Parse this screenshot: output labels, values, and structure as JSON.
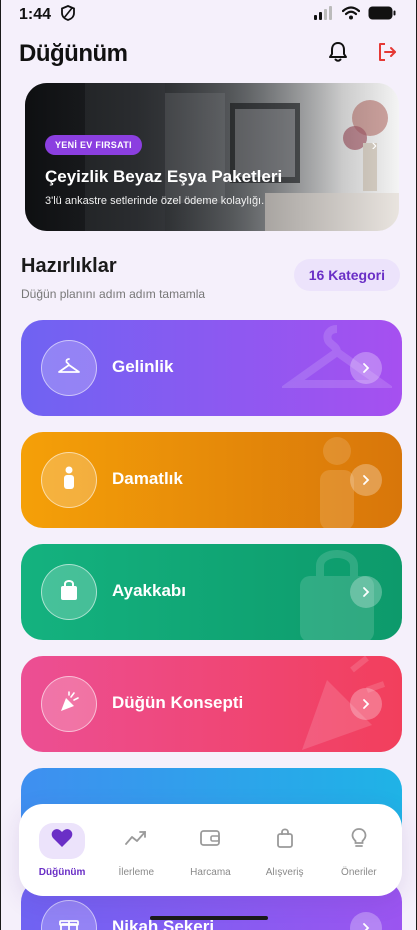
{
  "status_bar": {
    "time": "1:44"
  },
  "header": {
    "title": "Düğünüm"
  },
  "promo": {
    "badge": "YENİ EV FIRSATI",
    "title": "Çeyizlik Beyaz Eşya Paketleri",
    "subtitle": "3'lü ankastre setlerinde özel ödeme kolaylığı."
  },
  "section": {
    "title": "Hazırlıklar",
    "subtitle": "Düğün planını adım adım tamamla",
    "count_label": "16 Kategori"
  },
  "categories": [
    {
      "label": "Gelinlik",
      "icon": "hanger-icon",
      "color_from": "#6f63f2",
      "color_to": "#a650f0"
    },
    {
      "label": "Damatlık",
      "icon": "person-icon",
      "color_from": "#f5a008",
      "color_to": "#d8760a"
    },
    {
      "label": "Ayakkabı",
      "icon": "shopping-bag-icon",
      "color_from": "#14b27f",
      "color_to": "#0d9a6b"
    },
    {
      "label": "Düğün Konsepti",
      "icon": "party-popper-icon",
      "color_from": "#ec4f94",
      "color_to": "#f23f5c"
    },
    {
      "label": "",
      "icon": "",
      "color_from": "#3f8ff0",
      "color_to": "#1fb3e6"
    },
    {
      "label": "Nikah Şekeri",
      "icon": "gift-icon",
      "color_from": "#6f63f2",
      "color_to": "#9b55f0"
    }
  ],
  "nav": {
    "items": [
      {
        "label": "Düğünüm",
        "icon": "heart-icon",
        "active": true
      },
      {
        "label": "İlerleme",
        "icon": "trend-icon",
        "active": false
      },
      {
        "label": "Harcama",
        "icon": "wallet-icon",
        "active": false
      },
      {
        "label": "Alışveriş",
        "icon": "bag-icon",
        "active": false
      },
      {
        "label": "Öneriler",
        "icon": "lightbulb-icon",
        "active": false
      }
    ]
  },
  "colors": {
    "accent": "#6a2fc6",
    "accent_soft": "#ece3fb",
    "logout": "#e53935"
  }
}
